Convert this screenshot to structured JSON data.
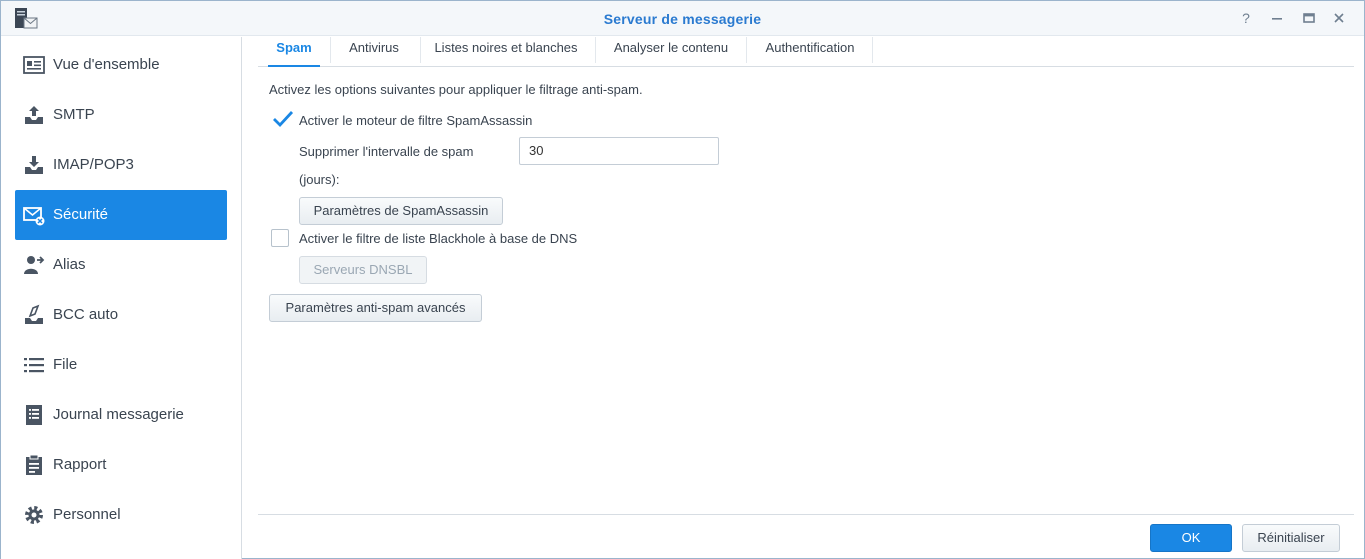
{
  "window": {
    "title": "Serveur de messagerie",
    "help_icon": "question-icon",
    "minimize_icon": "minimize-icon",
    "maximize_icon": "maximize-icon",
    "close_icon": "close-icon"
  },
  "sidebar": {
    "items": [
      {
        "label": "Vue d'ensemble",
        "icon": "overview-card-icon",
        "active": false
      },
      {
        "label": "SMTP",
        "icon": "tray-upload-icon",
        "active": false
      },
      {
        "label": "IMAP/POP3",
        "icon": "tray-download-icon",
        "active": false
      },
      {
        "label": "Sécurité",
        "icon": "envelope-shield-icon",
        "active": true
      },
      {
        "label": "Alias",
        "icon": "user-forward-icon",
        "active": false
      },
      {
        "label": "BCC auto",
        "icon": "inbox-copy-icon",
        "active": false
      },
      {
        "label": "File",
        "icon": "list-icon",
        "active": false
      },
      {
        "label": "Journal messagerie",
        "icon": "log-document-icon",
        "active": false
      },
      {
        "label": "Rapport",
        "icon": "clipboard-icon",
        "active": false
      },
      {
        "label": "Personnel",
        "icon": "gear-icon",
        "active": false
      }
    ]
  },
  "tabs": [
    {
      "label": "Spam",
      "active": true
    },
    {
      "label": "Antivirus",
      "active": false
    },
    {
      "label": "Listes noires et blanches",
      "active": false
    },
    {
      "label": "Analyser le contenu",
      "active": false
    },
    {
      "label": "Authentification",
      "active": false
    }
  ],
  "spam": {
    "description": "Activez les options suivantes pour appliquer le filtrage anti-spam.",
    "spamassassin_label": "Activer le moteur de filtre SpamAssassin",
    "spamassassin_checked": true,
    "interval_label_line1": "Supprimer l'intervalle de spam",
    "interval_label_line2": "(jours):",
    "interval_value": "30",
    "spamassassin_settings_button": "Paramètres de SpamAssassin",
    "dnsbl_label": "Activer le filtre de liste Blackhole à base de DNS",
    "dnsbl_checked": false,
    "dnsbl_servers_button": "Serveurs DNSBL",
    "advanced_button": "Paramètres anti-spam avancés"
  },
  "footer": {
    "ok_label": "OK",
    "reset_label": "Réinitialiser"
  },
  "colors": {
    "accent": "#1a87e4",
    "title": "#2a7ad0"
  }
}
